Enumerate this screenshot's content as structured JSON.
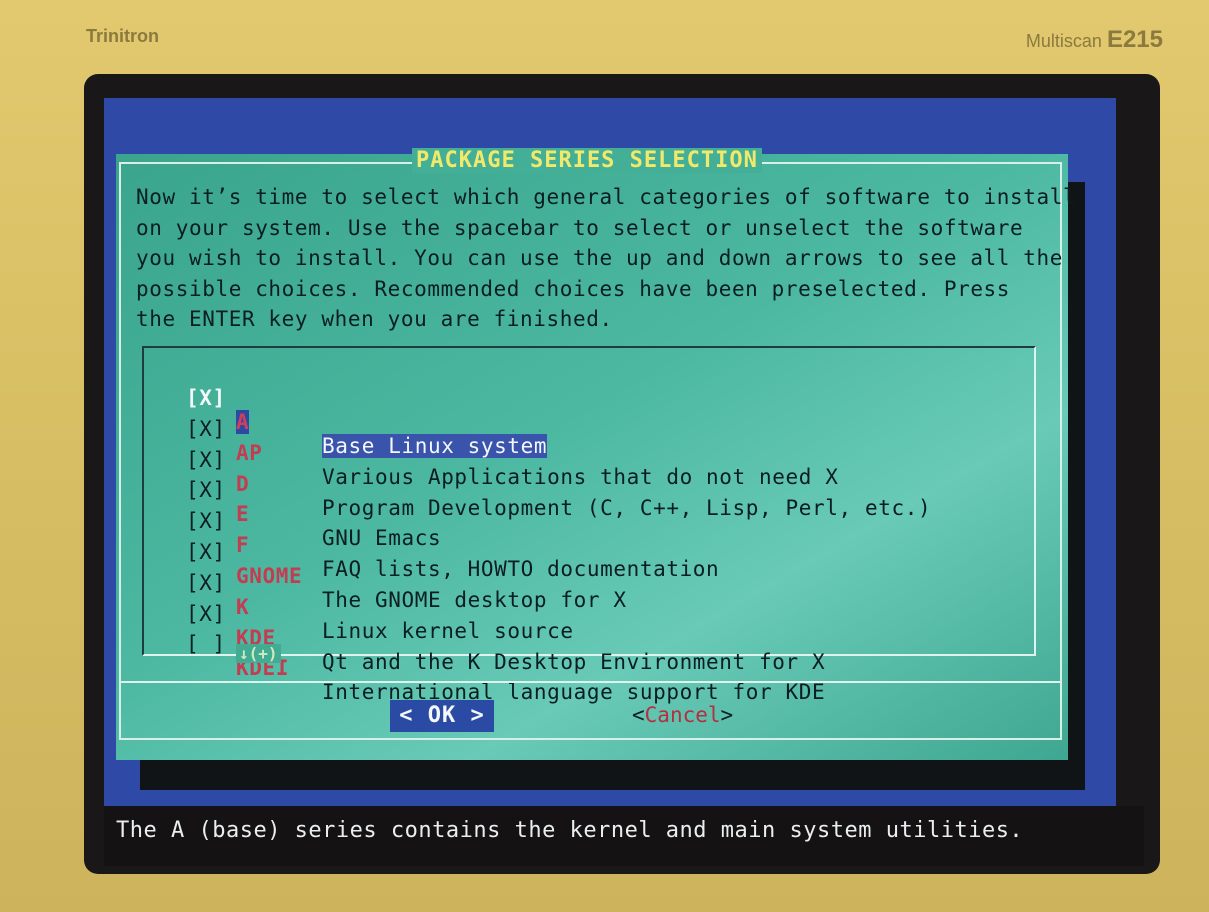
{
  "monitor": {
    "brand_left": "Trinitron",
    "brand_right_prefix": "Multiscan",
    "brand_right_model": "E215"
  },
  "dialog": {
    "title": "PACKAGE SERIES SELECTION",
    "intro_lines": [
      "Now it’s time to select which general categories of software to install",
      "on your system. Use the spacebar to select or unselect the software",
      "you wish to install. You can use the up and down arrows to see all the",
      "possible choices. Recommended choices have been preselected. Press",
      "the ENTER key when you are finished."
    ],
    "items": [
      {
        "check": "[X]",
        "tag": "A",
        "desc": "Base Linux system",
        "selected": true
      },
      {
        "check": "[X]",
        "tag": "AP",
        "desc": "Various Applications that do not need X",
        "selected": false
      },
      {
        "check": "[X]",
        "tag": "D",
        "desc": "Program Development (C, C++, Lisp, Perl, etc.)",
        "selected": false
      },
      {
        "check": "[X]",
        "tag": "E",
        "desc": "GNU Emacs",
        "selected": false
      },
      {
        "check": "[X]",
        "tag": "F",
        "desc": "FAQ lists, HOWTO documentation",
        "selected": false
      },
      {
        "check": "[X]",
        "tag": "GNOME",
        "desc": "The GNOME desktop for X",
        "selected": false
      },
      {
        "check": "[X]",
        "tag": "K",
        "desc": "Linux kernel source",
        "selected": false
      },
      {
        "check": "[X]",
        "tag": "KDE",
        "desc": "Qt and the K Desktop Environment for X",
        "selected": false
      },
      {
        "check": "[ ]",
        "tag": "KDEI",
        "desc": "International language support for KDE",
        "selected": false
      }
    ],
    "scroll_indicator": "↓(+)",
    "ok_label": "< OK >",
    "cancel_open": "<",
    "cancel_label": "Cancel",
    "cancel_close": ">"
  },
  "status_bar": {
    "text": "The A (base) series contains the kernel and main system utilities."
  },
  "colors": {
    "dialog_bg": "#44af97",
    "screen_bg": "#2e4aa6",
    "title_text": "#f2e86a",
    "tag_text": "#c23d52",
    "highlight_bg": "#2b4aa4"
  }
}
